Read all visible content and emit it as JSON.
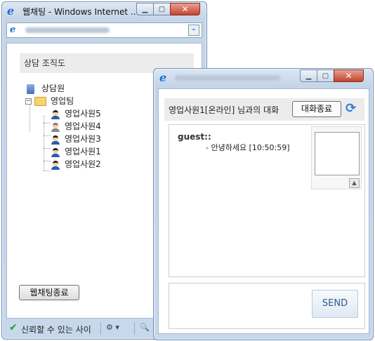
{
  "window1": {
    "title": "웹채팅 - Windows Internet ...",
    "section_title": "상담 조직도",
    "tree": {
      "root": "상담원",
      "team": "영업팀",
      "members": [
        "영업사원5",
        "영업사원4",
        "영업사원3",
        "영업사원1",
        "영업사원2"
      ]
    },
    "end_button": "웹채팅종료",
    "status_text": "신뢰할 수 있는 사이"
  },
  "window2": {
    "header_text": "영업사원1[온라인] 님과의 대화",
    "end_button": "대화종료",
    "chat": {
      "sender": "guest::",
      "message": "- 안녕하세요 [10:50:59]"
    },
    "send_button": "SEND"
  },
  "icons": {
    "browser": "ie-icon",
    "refresh": "refresh-icon",
    "person": "user-icon",
    "server": "server-icon",
    "folder": "folder-icon"
  },
  "colors": {
    "window_frame": "#c5d5e8",
    "close_button": "#c4442f",
    "header_bg": "#ececec",
    "send_text": "#2e5a8a"
  }
}
